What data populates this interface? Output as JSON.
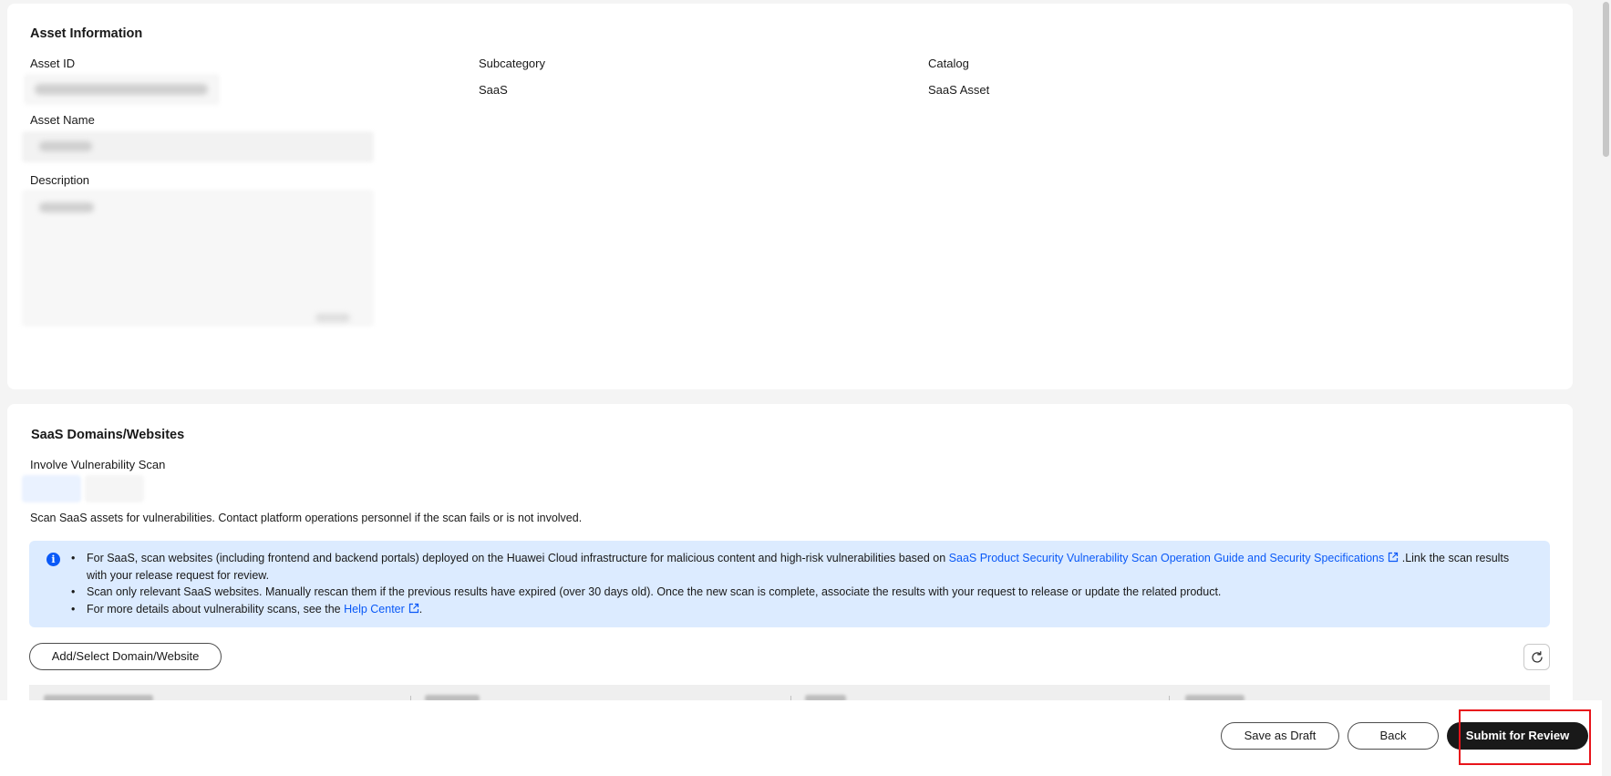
{
  "asset_information": {
    "title": "Asset Information",
    "asset_id_label": "Asset ID",
    "subcategory_label": "Subcategory",
    "subcategory_value": "SaaS",
    "catalog_label": "Catalog",
    "catalog_value": "SaaS Asset",
    "asset_name_label": "Asset Name",
    "description_label": "Description"
  },
  "saas_domains": {
    "title": "SaaS Domains/Websites",
    "involve_scan_label": "Involve Vulnerability Scan",
    "scan_hint": "Scan SaaS assets for vulnerabilities. Contact platform operations personnel if the scan fails or is not involved.",
    "info": {
      "item1_text": "For SaaS, scan websites (including frontend and backend portals) deployed on the Huawei Cloud infrastructure for malicious content and high-risk vulnerabilities based on ",
      "item1_link": "SaaS Product Security Vulnerability Scan Operation Guide and Security Specifications",
      "item1_suffix": " .Link the scan results with your release request for review.",
      "item2_text": "Scan only relevant SaaS websites. Manually rescan them if the previous results have expired (over 30 days old). Once the new scan is complete, associate the results with your request to release or update the related product.",
      "item3_text": "For more details about vulnerability scans, see the ",
      "item3_link": "Help Center",
      "item3_suffix": "."
    },
    "add_button_label": "Add/Select Domain/Website"
  },
  "footer": {
    "save_draft_label": "Save as Draft",
    "back_label": "Back",
    "submit_label": "Submit for Review"
  },
  "colors": {
    "primary": "#191919",
    "link": "#0a59f7",
    "info_bg": "#dcebff",
    "highlight": "#e8141b"
  }
}
